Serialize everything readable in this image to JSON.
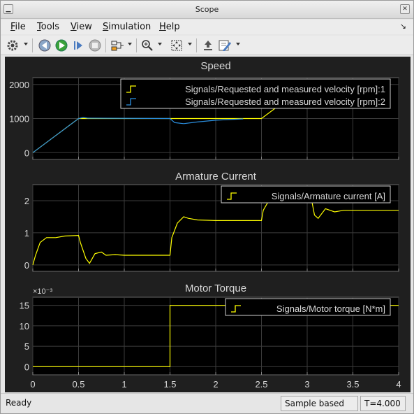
{
  "window": {
    "title": "Scope"
  },
  "menu": {
    "items": [
      {
        "label": "File",
        "mnemonic": "F",
        "rest": "ile"
      },
      {
        "label": "Tools",
        "mnemonic": "T",
        "rest": "ools"
      },
      {
        "label": "View",
        "mnemonic": "V",
        "rest": "iew"
      },
      {
        "label": "Simulation",
        "mnemonic": "S",
        "rest": "imulation"
      },
      {
        "label": "Help",
        "mnemonic": "H",
        "rest": "elp"
      }
    ],
    "dock_arrow": "↘"
  },
  "toolbar": {
    "icons": [
      "gear-icon",
      "step-back-icon",
      "run-icon",
      "step-forward-icon",
      "stop-icon",
      "signal-highlight-icon",
      "zoom-in-icon",
      "fit-view-icon",
      "restore-view-icon",
      "edit-style-icon"
    ]
  },
  "status": {
    "ready": "Ready",
    "mode": "Sample based",
    "time": "T=4.000"
  },
  "colors": {
    "yellow": "#ffff00",
    "blue": "#2b8fe0",
    "axes_bg": "#000000",
    "panel_bg": "#1f1f1f",
    "text": "#d8d8d8"
  },
  "chart_data": [
    {
      "type": "line",
      "title": "Speed",
      "xlim": [
        0,
        4
      ],
      "ylim": [
        -200,
        2200
      ],
      "yticks": [
        0,
        1000,
        2000
      ],
      "legend_loc": "top-right",
      "series": [
        {
          "name": "Signals/Requested and measured velocity [rpm]:1",
          "color": "#ffff00",
          "x": [
            0,
            0.5,
            1.5,
            2.5,
            3.0
          ],
          "y": [
            0,
            1000,
            1000,
            1000,
            2000
          ]
        },
        {
          "name": "Signals/Requested and measured velocity [rpm]:2",
          "color": "#2b8fe0",
          "x": [
            0,
            0.5,
            0.55,
            0.6,
            1.5,
            1.55,
            1.65,
            1.8,
            2.0,
            2.3
          ],
          "y": [
            0,
            1000,
            1030,
            1010,
            1000,
            880,
            850,
            900,
            950,
            990
          ]
        }
      ]
    },
    {
      "type": "line",
      "title": "Armature Current",
      "xlim": [
        0,
        4
      ],
      "ylim": [
        -0.2,
        2.5
      ],
      "yticks": [
        0,
        1,
        2
      ],
      "legend_loc": "top-right",
      "series": [
        {
          "name": "Signals/Armature current [A]",
          "color": "#ffff00",
          "x": [
            0,
            0.03,
            0.08,
            0.15,
            0.25,
            0.35,
            0.5,
            0.52,
            0.58,
            0.62,
            0.68,
            0.75,
            0.8,
            0.9,
            1.0,
            1.5,
            1.52,
            1.58,
            1.65,
            1.7,
            1.8,
            2.0,
            2.5,
            2.52,
            2.58,
            3.05,
            3.08,
            3.12,
            3.2,
            3.3,
            3.4,
            4.0
          ],
          "y": [
            0,
            0.3,
            0.7,
            0.85,
            0.85,
            0.9,
            0.92,
            0.7,
            0.2,
            0.05,
            0.35,
            0.4,
            0.3,
            0.32,
            0.3,
            0.3,
            0.85,
            1.3,
            1.5,
            1.45,
            1.4,
            1.38,
            1.38,
            1.7,
            2.0,
            2.0,
            1.55,
            1.45,
            1.75,
            1.65,
            1.7,
            1.7
          ]
        }
      ]
    },
    {
      "type": "line",
      "title": "Motor Torque",
      "exponent_label": "×10⁻³",
      "xlim": [
        0,
        4
      ],
      "ylim": [
        -2,
        17
      ],
      "yticks": [
        0,
        5,
        10,
        15
      ],
      "xticks": [
        0,
        0.5,
        1,
        1.5,
        2,
        2.5,
        3,
        3.5,
        4
      ],
      "xtick_labels": [
        "0",
        "0.5",
        "1",
        "1.5",
        "2",
        "2.5",
        "3",
        "3.5",
        "4"
      ],
      "legend_loc": "top-right",
      "series": [
        {
          "name": "Signals/Motor torque [N*m]",
          "color": "#ffff00",
          "x": [
            0,
            1.5,
            1.5,
            4.0
          ],
          "y": [
            0,
            0,
            15,
            15
          ]
        }
      ]
    }
  ]
}
